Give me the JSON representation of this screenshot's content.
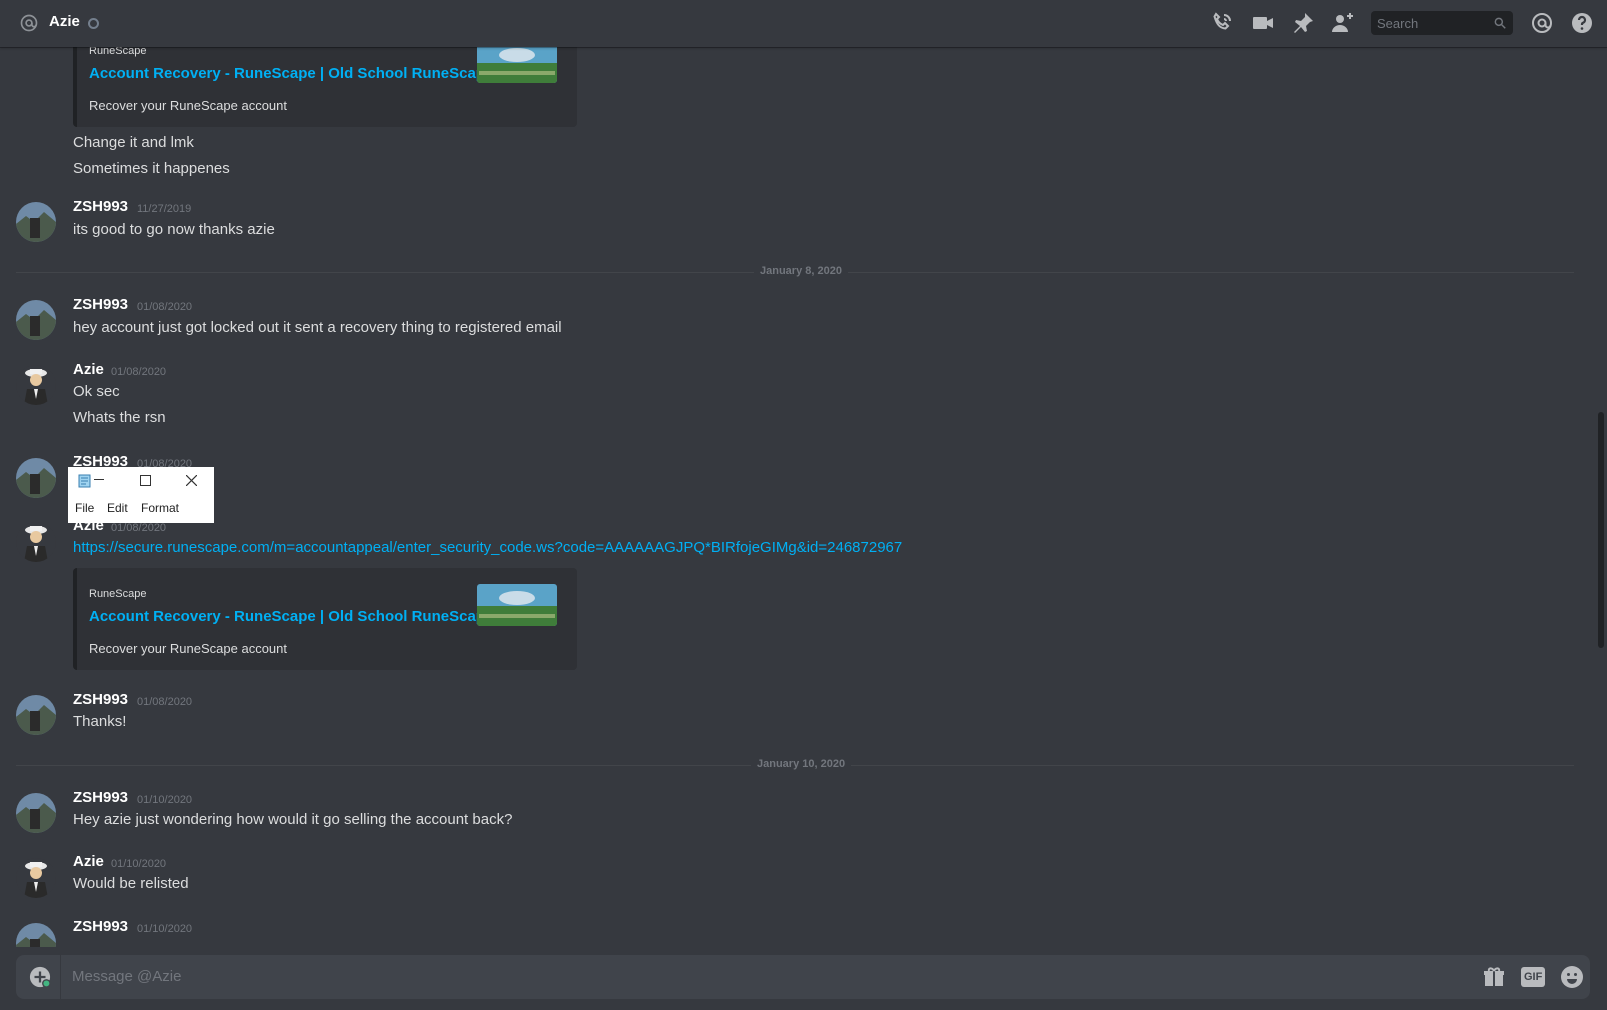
{
  "header": {
    "title": "Azie",
    "search_placeholder": "Search",
    "icons": [
      "at-icon",
      "status-icon",
      "call-icon",
      "video-icon",
      "pin-icon",
      "add-friend-icon",
      "search-icon",
      "mention-icon",
      "help-icon"
    ]
  },
  "embed": {
    "provider": "RuneScape",
    "title": "Account Recovery - RuneScape | Old School RuneScape",
    "description": "Recover your RuneScape account"
  },
  "messages": {
    "top_lines": [
      "Change it and lmk",
      "Sometimes it happenes"
    ],
    "m1": {
      "user": "ZSH993",
      "time": "11/27/2019",
      "text": "its good to go now thanks azie"
    },
    "divider1": "January 8, 2020",
    "m2": {
      "user": "ZSH993",
      "time": "01/08/2020",
      "text": "hey account just got locked out it sent a recovery thing to registered email"
    },
    "m3": {
      "user": "Azie",
      "time": "01/08/2020",
      "text1": "Ok sec",
      "text2": "Whats the rsn"
    },
    "m4": {
      "user": "ZSH993",
      "time": "01/08/2020"
    },
    "m5": {
      "user": "Azie",
      "time": "01/08/2020",
      "link": "https://secure.runescape.com/m=accountappeal/enter_security_code.ws?code=AAAAAAGJPQ*BIRfojeGIMg&id=246872967"
    },
    "m6": {
      "user": "ZSH993",
      "time": "01/08/2020",
      "text": "Thanks!"
    },
    "divider2": "January 10, 2020",
    "m7": {
      "user": "ZSH993",
      "time": "01/10/2020",
      "text": "Hey azie just wondering how would it go selling the account back?"
    },
    "m8": {
      "user": "Azie",
      "time": "01/10/2020",
      "text": "Would be relisted"
    },
    "m9": {
      "user": "ZSH993",
      "time": "01/10/2020"
    }
  },
  "notepad": {
    "menu": [
      "File",
      "Edit",
      "Format"
    ]
  },
  "composer": {
    "placeholder": "Message @Azie",
    "gif_label": "GIF"
  },
  "colors": {
    "background": "#36393f",
    "link": "#00b0f4",
    "muted": "#72767d",
    "text": "#dcddde"
  }
}
